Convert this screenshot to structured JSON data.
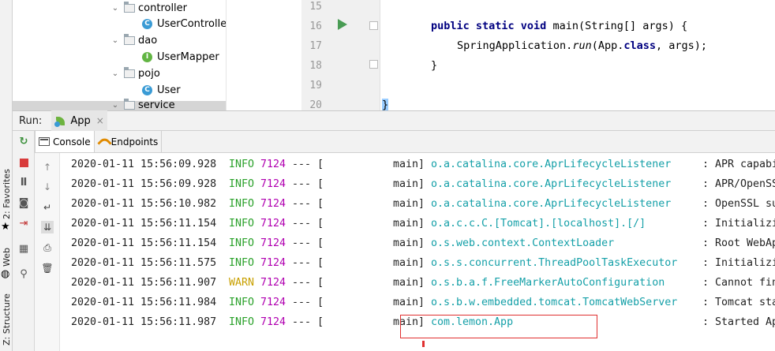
{
  "project_tree": {
    "items": [
      {
        "type": "folder",
        "label": "controller",
        "expanded": true
      },
      {
        "type": "class",
        "label": "UserController",
        "icon": "C"
      },
      {
        "type": "folder",
        "label": "dao",
        "expanded": true
      },
      {
        "type": "interface",
        "label": "UserMapper",
        "icon": "I"
      },
      {
        "type": "folder",
        "label": "pojo",
        "expanded": true
      },
      {
        "type": "class",
        "label": "User",
        "icon": "C"
      },
      {
        "type": "folder",
        "label": "service",
        "expanded": true
      }
    ]
  },
  "editor": {
    "line_numbers": [
      "15",
      "16",
      "17",
      "18",
      "19",
      "20"
    ],
    "code": {
      "l16_kw": "public static void",
      "l16_rest": " main(String[] args) {",
      "l17_a": "SpringApplication.",
      "l17_run": "run",
      "l17_b": "(App.",
      "l17_kw": "class",
      "l17_c": ", args);",
      "l18": "}",
      "l20": "}"
    }
  },
  "run_bar": {
    "label": "Run:",
    "tab_label": "App",
    "close": "×"
  },
  "side_tabs": {
    "favorites": "2: Favorites",
    "web": "Web",
    "structure": "Z: Structure"
  },
  "console_tabs": {
    "console": "Console",
    "endpoints": "Endpoints"
  },
  "console": {
    "lines": [
      {
        "ts": "2020-01-11 15:56:09.928",
        "level": "INFO",
        "pid": "7124",
        "sep": "--- [",
        "thread": "main]",
        "logger": "o.a.catalina.core.AprLifecycleListener",
        "msg": ": APR capabili"
      },
      {
        "ts": "2020-01-11 15:56:09.928",
        "level": "INFO",
        "pid": "7124",
        "sep": "--- [",
        "thread": "main]",
        "logger": "o.a.catalina.core.AprLifecycleListener",
        "msg": ": APR/OpenSSL"
      },
      {
        "ts": "2020-01-11 15:56:10.982",
        "level": "INFO",
        "pid": "7124",
        "sep": "--- [",
        "thread": "main]",
        "logger": "o.a.catalina.core.AprLifecycleListener",
        "msg": ": OpenSSL succ"
      },
      {
        "ts": "2020-01-11 15:56:11.154",
        "level": "INFO",
        "pid": "7124",
        "sep": "--- [",
        "thread": "main]",
        "logger": "o.a.c.c.C.[Tomcat].[localhost].[/]",
        "msg": ": Initializing"
      },
      {
        "ts": "2020-01-11 15:56:11.154",
        "level": "INFO",
        "pid": "7124",
        "sep": "--- [",
        "thread": "main]",
        "logger": "o.s.web.context.ContextLoader",
        "msg": ": Root WebAppl"
      },
      {
        "ts": "2020-01-11 15:56:11.575",
        "level": "INFO",
        "pid": "7124",
        "sep": "--- [",
        "thread": "main]",
        "logger": "o.s.s.concurrent.ThreadPoolTaskExecutor",
        "msg": ": Initializing"
      },
      {
        "ts": "2020-01-11 15:56:11.907",
        "level": "WARN",
        "pid": "7124",
        "sep": "--- [",
        "thread": "main]",
        "logger": "o.s.b.a.f.FreeMarkerAutoConfiguration",
        "msg": ": Cannot find"
      },
      {
        "ts": "2020-01-11 15:56:11.984",
        "level": "INFO",
        "pid": "7124",
        "sep": "--- [",
        "thread": "main]",
        "logger": "o.s.b.w.embedded.tomcat.TomcatWebServer",
        "msg": ": Tomcat start"
      },
      {
        "ts": "2020-01-11 15:56:11.987",
        "level": "INFO",
        "pid": "7124",
        "sep": "--- [",
        "thread": "main]",
        "logger": "com.lemon.App",
        "msg": ": Started App"
      }
    ]
  },
  "colors": {
    "info": "#2aa12a",
    "warn": "#c8a000",
    "pid": "#b000b0",
    "logger": "#15a0a8",
    "highlight": "#e03030"
  }
}
